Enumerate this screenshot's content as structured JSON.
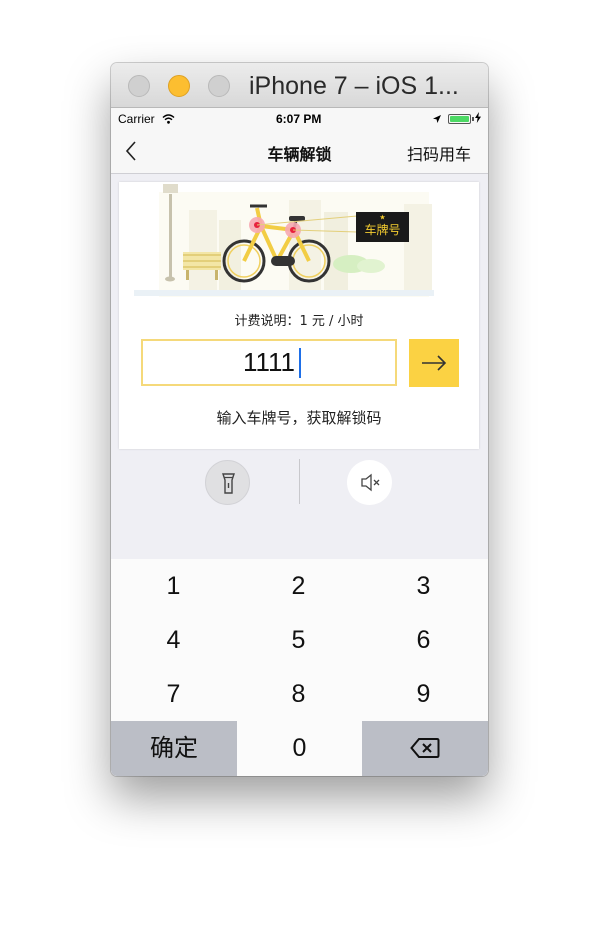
{
  "window": {
    "title": "iPhone 7 – iOS 1..."
  },
  "status_bar": {
    "carrier": "Carrier",
    "time": "6:07 PM"
  },
  "nav": {
    "title": "车辆解锁",
    "right_action": "扫码用车"
  },
  "card": {
    "plate_badge": "车牌号",
    "fee_text": "计费说明：1 元 / 小时",
    "plate_input_value": "1111",
    "hint": "输入车牌号，获取解锁码"
  },
  "keypad": {
    "keys": [
      "1",
      "2",
      "3",
      "4",
      "5",
      "6",
      "7",
      "8",
      "9"
    ],
    "confirm_label": "确定",
    "zero_label": "0"
  },
  "colors": {
    "accent_yellow": "#fbd243",
    "input_border": "#f5d97a",
    "caret_blue": "#1e6fe8"
  }
}
